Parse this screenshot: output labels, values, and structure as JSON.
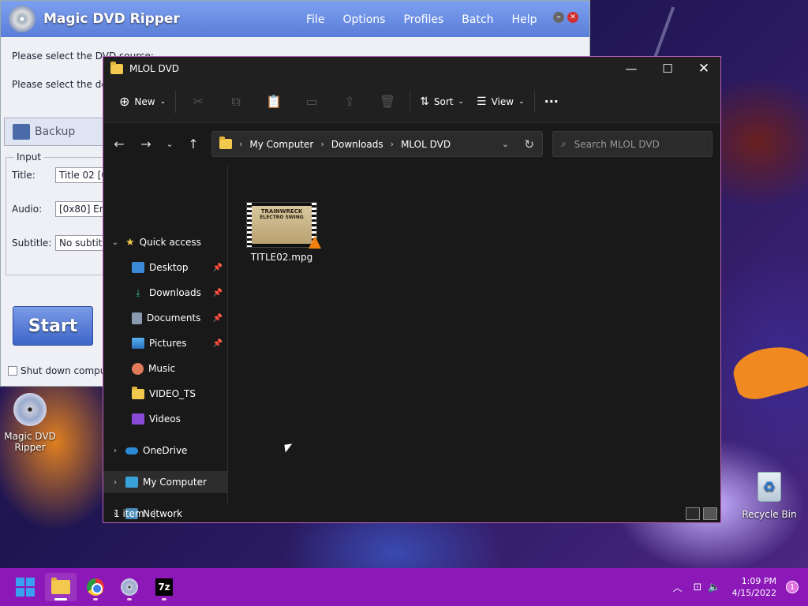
{
  "mdr": {
    "title": "Magic DVD Ripper",
    "menu": [
      "File",
      "Options",
      "Profiles",
      "Batch",
      "Help"
    ],
    "source_label": "Please select the DVD source:",
    "dest_label": "Please select the des",
    "backup_tab": "Backup",
    "input_group": "Input",
    "title_label": "Title:",
    "title_value": "Title 02 [0",
    "audio_label": "Audio:",
    "audio_value": "[0x80] En",
    "subtitle_label": "Subtitle:",
    "subtitle_value": "No subtitle",
    "start_label": "Start",
    "shutdown_label": "Shut down comput"
  },
  "desktop": {
    "dvd_icon_label": "Magic DVD Ripper",
    "recycle_bin_label": "Recycle Bin"
  },
  "explorer": {
    "title": "MLOL DVD",
    "toolbar": {
      "new_label": "New",
      "sort_label": "Sort",
      "view_label": "View",
      "more_label": "···"
    },
    "address": {
      "crumbs": [
        "My Computer",
        "Downloads",
        "MLOL DVD"
      ]
    },
    "search_placeholder": "Search MLOL DVD",
    "sidebar": {
      "quick_access": "Quick access",
      "items": [
        "Desktop",
        "Downloads",
        "Documents",
        "Pictures",
        "Music",
        "VIDEO_TS",
        "Videos"
      ],
      "onedrive": "OneDrive",
      "my_computer": "My Computer",
      "network": "Network"
    },
    "file": {
      "name": "TITLE02.mpg",
      "thumb_line1": "TRAINWRECK",
      "thumb_line2": "ELECTRO SWING"
    },
    "status": "1 item"
  },
  "taskbar": {
    "time": "1:09 PM",
    "date": "4/15/2022",
    "sevenzip_label": "7z",
    "notification_count": "1"
  },
  "colors": {
    "taskbar": "#8c18b8",
    "explorer_bg": "#191919",
    "accent_folder": "#f2c94c"
  }
}
